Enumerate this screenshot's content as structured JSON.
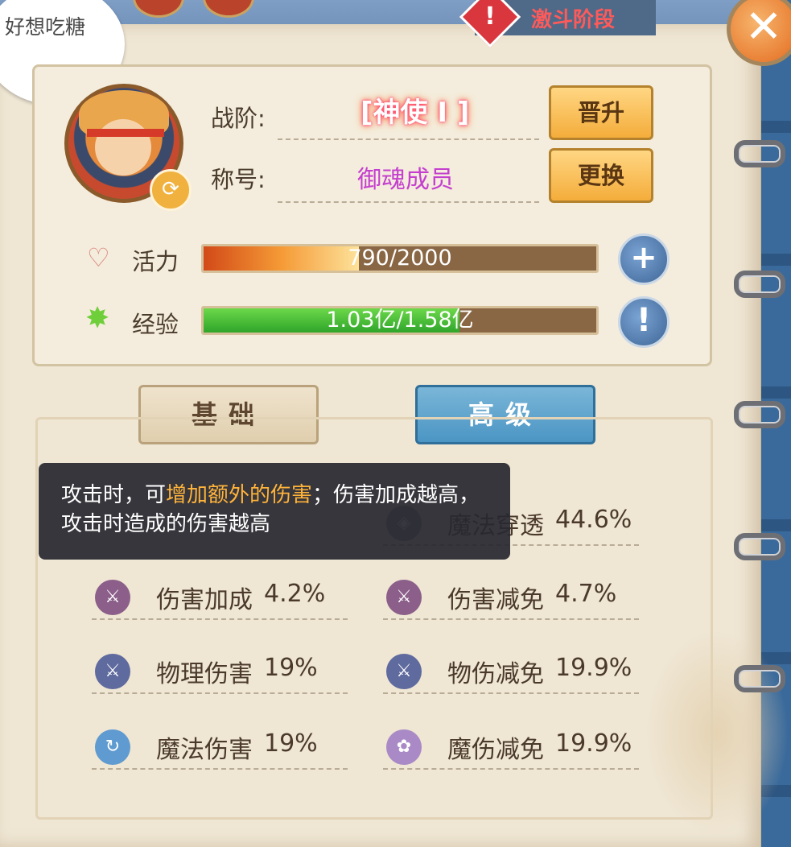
{
  "bubble": {
    "text": "好想吃糖"
  },
  "stage": {
    "icon": "warning-icon",
    "text": "激斗阶段"
  },
  "close": {
    "icon": "close-icon",
    "glyph": "✕"
  },
  "profile": {
    "rank_label": "战阶:",
    "rank_value": "[神使 I ]",
    "title_label": "称号:",
    "title_value": "御魂成员",
    "promote_button": "晋升",
    "change_button": "更换"
  },
  "vitality": {
    "label": "活力",
    "text": "790/2000",
    "current": 790,
    "max": 2000,
    "icon": "heart-icon",
    "add": "+"
  },
  "experience": {
    "label": "经验",
    "text": "1.03亿/1.58亿",
    "current": 1.03,
    "max": 1.58,
    "icon": "star-icon",
    "info": "!"
  },
  "tabs": {
    "basic": "基础",
    "advanced": "高级"
  },
  "tooltip": {
    "part1": "攻击时，可",
    "highlight": "增加额外的伤害",
    "part2": "；伤害加成越高，攻击时造成的伤害越高"
  },
  "stats": {
    "left": [
      {
        "name": "伤害加成",
        "value": "4.2%",
        "icon": "sword-up-icon",
        "color": "#8b5f8a"
      },
      {
        "name": "物理伤害",
        "value": "19%",
        "icon": "sword-up-icon",
        "color": "#5f6a9e"
      },
      {
        "name": "魔法伤害",
        "value": "19%",
        "icon": "magic-icon",
        "color": "#5f9ad0"
      }
    ],
    "right": [
      {
        "name": "魔法穿透",
        "value": "44.6%",
        "icon": "shield-icon",
        "color": "#8f8f8f"
      },
      {
        "name": "伤害减免",
        "value": "4.7%",
        "icon": "sword-down-icon",
        "color": "#8b5f8a"
      },
      {
        "name": "物伤减免",
        "value": "19.9%",
        "icon": "sword-down-icon",
        "color": "#5f6a9e"
      },
      {
        "name": "魔伤减免",
        "value": "19.9%",
        "icon": "magic-down-icon",
        "color": "#a98ac6"
      }
    ]
  }
}
